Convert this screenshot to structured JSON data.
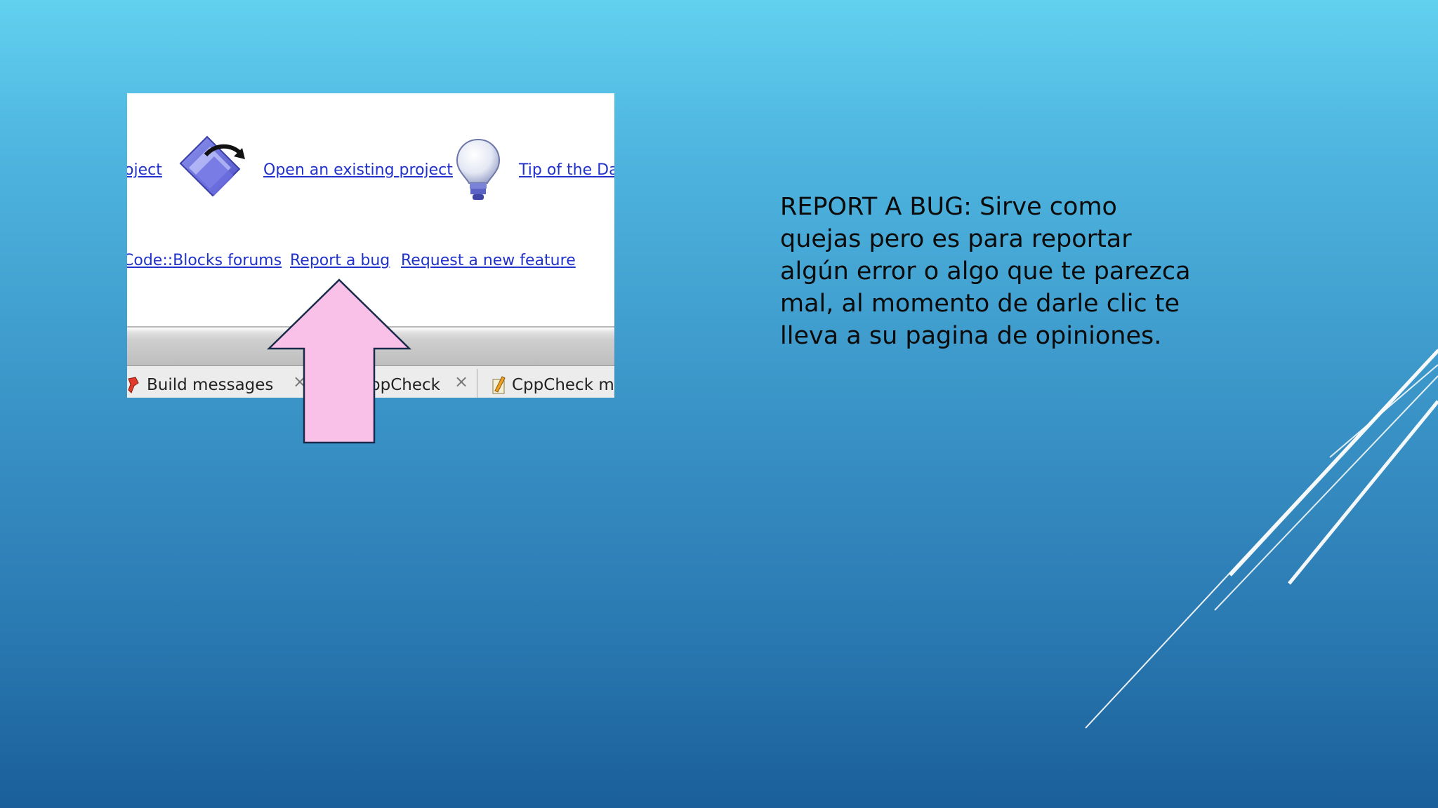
{
  "screenshot": {
    "links_row1": [
      {
        "label": "oject"
      },
      {
        "label": "Open an existing project"
      },
      {
        "label": "Tip of the Day"
      }
    ],
    "links_row2": [
      {
        "label": "Code::Blocks forums"
      },
      {
        "label": "Report a bug"
      },
      {
        "label": "Request a new feature"
      }
    ],
    "tabs": [
      {
        "label": "Build messages"
      },
      {
        "label": "ppCheck"
      },
      {
        "label": "CppCheck mes"
      }
    ],
    "tab_close_glyph": "×"
  },
  "description": {
    "text": "REPORT A BUG: Sirve como quejas pero es para reportar algún error o algo que te parezca mal, al momento de darle clic te lleva a su pagina de opiniones."
  },
  "colors": {
    "link": "#2233cc",
    "arrow_fill": "#f9c0e8",
    "arrow_stroke": "#1a2a4a"
  }
}
